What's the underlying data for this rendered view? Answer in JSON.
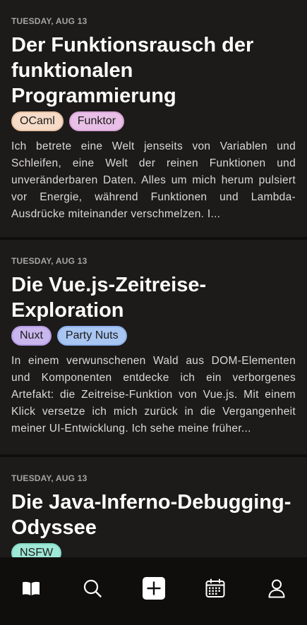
{
  "posts": [
    {
      "date": "TUESDAY, AUG 13",
      "title": "Der Funktionsrausch der funktionalen Programmierung",
      "tags": [
        {
          "label": "OCaml",
          "bg": "#f6dcc8",
          "border": "#e9c3a6"
        },
        {
          "label": "Funktor",
          "bg": "#e8bfe6",
          "border": "#d9a5d6"
        }
      ],
      "excerpt": "Ich betrete eine Welt jenseits von Variablen und Schleifen, eine Welt der reinen Funktionen und unveränderbaren Daten. Alles um mich herum pulsiert vor Energie, während Funktionen und Lambda-Ausdrücke miteinander verschmelzen. I..."
    },
    {
      "date": "TUESDAY, AUG 13",
      "title": "Die Vue.js-Zeitreise-Exploration",
      "tags": [
        {
          "label": "Nuxt",
          "bg": "#c9b6ee",
          "border": "#b59ee4"
        },
        {
          "label": "Party Nuts",
          "bg": "#a9c6f3",
          "border": "#8fb3ec"
        }
      ],
      "excerpt": "In einem verwunschenen Wald aus DOM-Elementen und Komponenten entdecke ich ein verborgenes Artefakt: die Zeitreise-Funktion von Vue.js. Mit einem Klick versetze ich mich zurück in die Vergangenheit meiner UI-Entwicklung. Ich sehe meine früher..."
    },
    {
      "date": "TUESDAY, AUG 13",
      "title": "Die Java-Inferno-Debugging-Odyssee",
      "tags": [
        {
          "label": "NSFW",
          "bg": "#9fe7d6",
          "border": "#84dcc7"
        }
      ],
      "excerpt": ""
    }
  ],
  "tabbar": {
    "items": [
      {
        "name": "journal",
        "icon": "book-open-icon"
      },
      {
        "name": "search",
        "icon": "search-icon"
      },
      {
        "name": "new-entry",
        "icon": "plus-square-icon"
      },
      {
        "name": "calendar",
        "icon": "calendar-icon"
      },
      {
        "name": "profile",
        "icon": "user-icon"
      }
    ]
  },
  "colors": {
    "background": "#0f0e0d",
    "card": "#1d1b1a",
    "text": "#ffffff",
    "muted": "#a7a5a2"
  }
}
